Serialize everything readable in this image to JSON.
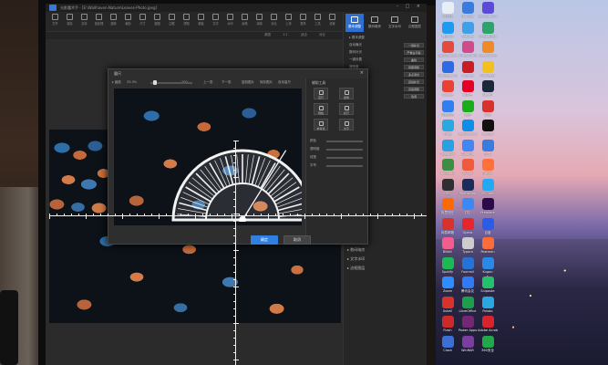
{
  "app": {
    "title": "光影魔术手 - [E:\\Wallhaven-Nature\\Leaves-Photo.jpeg]",
    "window_controls": "- □ ×"
  },
  "toolbar": {
    "items": [
      "打开",
      "保存",
      "另存",
      "批处理",
      "旋转",
      "裁剪",
      "尺寸",
      "抠图",
      "边框",
      "拼图",
      "模板",
      "文字",
      "水印",
      "画笔",
      "涂鸦",
      "对比",
      "上传",
      "更多",
      "工具",
      "设置"
    ]
  },
  "subbar": {
    "items": [
      "原图",
      "1:1",
      "适合",
      "对比"
    ]
  },
  "right_panel": {
    "tabs": [
      "基本调整",
      "数码暗房",
      "文字水印",
      "边框图层"
    ],
    "active_tab": 0,
    "section_title": "▸ 基本调整",
    "rows": [
      "自动曝光",
      "数码补光",
      "一键设置",
      "清晰度",
      "曲线调整",
      "色阶调整",
      "色彩平衡",
      "RGB色调"
    ],
    "buttons": [
      "一键补光",
      "严重白平衡",
      "曲线",
      "局部调整",
      "多点测光",
      "自动补光",
      "高级调整",
      "色调"
    ],
    "footer": [
      "▸ 数码暗房",
      "▸ 文字水印",
      "▸ 边框图层"
    ]
  },
  "dialog": {
    "title": "量尺",
    "bar": [
      "▸ 缩放",
      "33.3%",
      "100",
      "上一张",
      "下一张",
      "复制图片",
      "保存图片",
      "自动量尺"
    ],
    "zoom_fraction": 0.08,
    "side_title": "辅助工具",
    "side_buttons": [
      "直尺",
      "量角",
      "网格",
      "标尺",
      "参考线",
      "文字"
    ],
    "labels": [
      "颜色",
      "透明度",
      "线宽",
      "字号"
    ],
    "ok": "确定",
    "cancel": "取消"
  },
  "protractor": {
    "tick_count": 36,
    "arm_angle_deg": 58
  },
  "desktop_icons": [
    {
      "label": "回收站",
      "color": "#e8eef5"
    },
    {
      "label": "Thunder",
      "color": "#3a7be0"
    },
    {
      "label": "Revelation Launcher",
      "color": "#5b4bd6"
    },
    {
      "label": "腾讯QQ",
      "color": "#1d9bf0"
    },
    {
      "label": "Pictures",
      "color": "#3fa0e8"
    },
    {
      "label": "CrystalDisk",
      "color": "#2ea36b"
    },
    {
      "label": "EasyCamera",
      "color": "#e64a3a"
    },
    {
      "label": "Virtual Studio",
      "color": "#d14a8a"
    },
    {
      "label": "Everything",
      "color": "#f08a24"
    },
    {
      "label": "Wallpaper Engine",
      "color": "#2d6be6"
    },
    {
      "label": "Huawei",
      "color": "#c81d25"
    },
    {
      "label": "PotPlayer",
      "color": "#f2c21b"
    },
    {
      "label": "Google",
      "color": "#e94235"
    },
    {
      "label": "网易云",
      "color": "#e60026"
    },
    {
      "label": "Steam",
      "color": "#1b2838"
    },
    {
      "label": "百度网盘",
      "color": "#2f7ff1"
    },
    {
      "label": "微信",
      "color": "#1aad19"
    },
    {
      "label": "WPS",
      "color": "#d9322d"
    },
    {
      "label": "Edge",
      "color": "#2aa8e0"
    },
    {
      "label": "TeamViewer",
      "color": "#0e8ee9"
    },
    {
      "label": "CapCut",
      "color": "#111111"
    },
    {
      "label": "Telegram",
      "color": "#27a1e3"
    },
    {
      "label": "Chrome",
      "color": "#4285f4"
    },
    {
      "label": "迅雷",
      "color": "#3a7be0"
    },
    {
      "label": "Notepad",
      "color": "#3b8e43"
    },
    {
      "label": "XMind",
      "color": "#ef5a3c"
    },
    {
      "label": "Firefox",
      "color": "#ff7139"
    },
    {
      "label": "OBS",
      "color": "#302e31"
    },
    {
      "label": "Photoshop",
      "color": "#1c2c5a"
    },
    {
      "label": "VS Code",
      "color": "#23a9f2"
    },
    {
      "label": "阿里旺旺",
      "color": "#ff6a00"
    },
    {
      "label": "钉钉",
      "color": "#3a89f7"
    },
    {
      "label": "Premiere",
      "color": "#2a0a4a"
    },
    {
      "label": "网易邮箱",
      "color": "#d9322d"
    },
    {
      "label": "Opera",
      "color": "#e5262b"
    },
    {
      "label": "百度",
      "color": "#2b5ce8"
    },
    {
      "label": "Bilibili",
      "color": "#f25d8e"
    },
    {
      "label": "Typora",
      "color": "#cccccc"
    },
    {
      "label": "Postman",
      "color": "#ff6c37"
    },
    {
      "label": "Spotify",
      "color": "#1db954"
    },
    {
      "label": "Foxmail",
      "color": "#2673d8"
    },
    {
      "label": "Kugou",
      "color": "#2a88e8"
    },
    {
      "label": "Zoom",
      "color": "#2d8cff"
    },
    {
      "label": "腾讯会议",
      "color": "#2f7bf5"
    },
    {
      "label": "Snipaste",
      "color": "#25c06d"
    },
    {
      "label": "Xshell",
      "color": "#d9322d"
    },
    {
      "label": "LibreOffice",
      "color": "#1d9e4a"
    },
    {
      "label": "Potato",
      "color": "#2aa6e0"
    },
    {
      "label": "Flash",
      "color": "#cc2a2a"
    },
    {
      "label": "Power Apps",
      "color": "#742774"
    },
    {
      "label": "Adobe Acrobat DC",
      "color": "#d9232d"
    },
    {
      "label": "Clash",
      "color": "#3b6fd6"
    },
    {
      "label": "WinRAR",
      "color": "#7a3ea0"
    },
    {
      "label": "360安全",
      "color": "#21a84b"
    }
  ]
}
